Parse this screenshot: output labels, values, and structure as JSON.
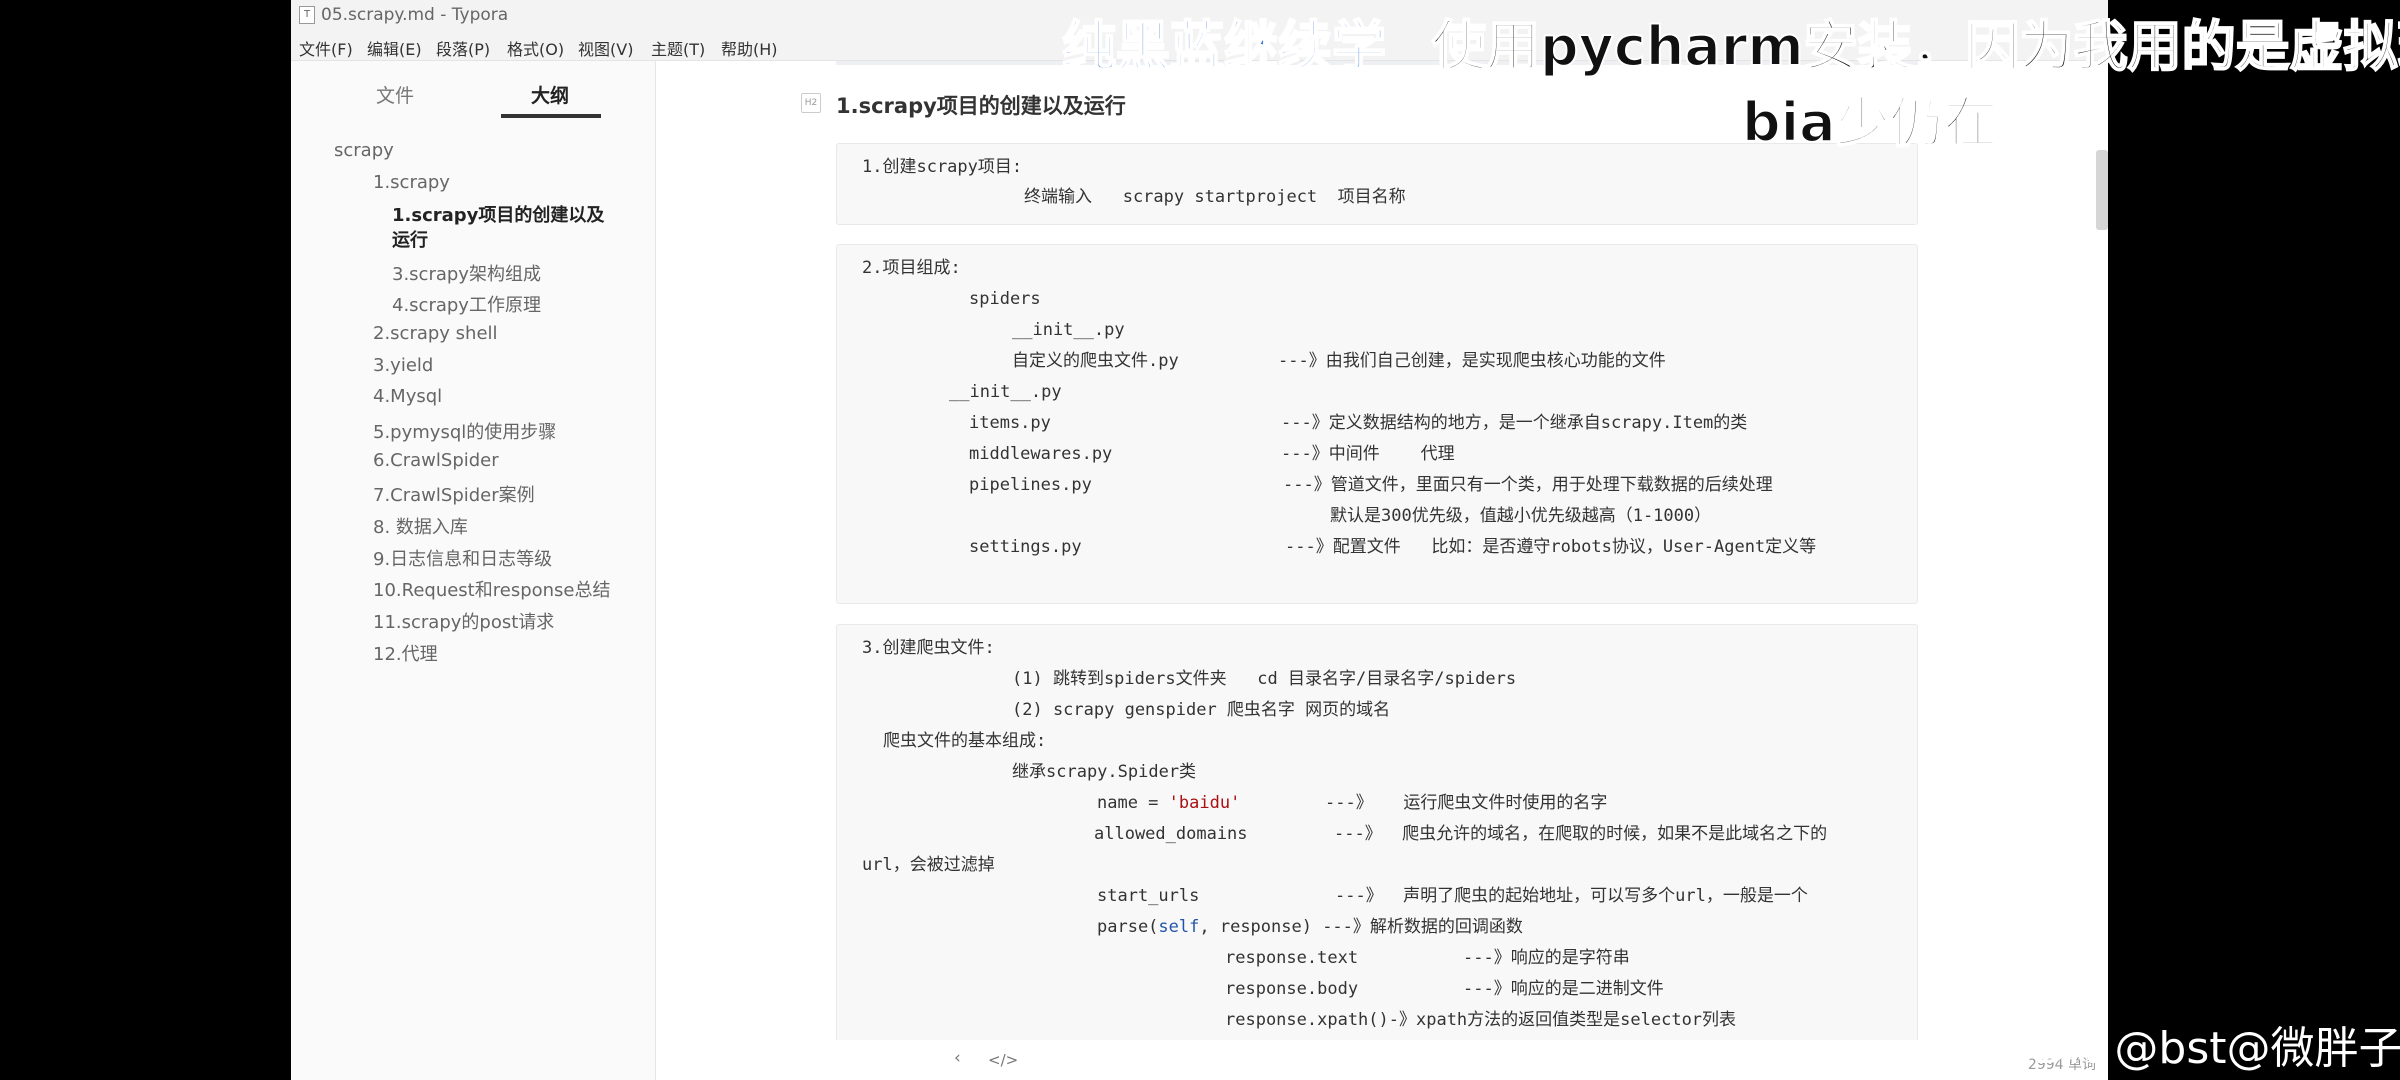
{
  "window": {
    "title": "05.scrapy.md - Typora"
  },
  "menu": [
    "文件(F)",
    "编辑(E)",
    "段落(P)",
    "格式(O)",
    "视图(V)",
    "主题(T)",
    "帮助(H)"
  ],
  "sidebar": {
    "tabs": [
      {
        "label": "文件"
      },
      {
        "label": "大纲"
      }
    ],
    "items": [
      {
        "label": "scrapy"
      },
      {
        "label": "1.scrapy"
      },
      {
        "label": "1.scrapy项目的创建以及运行"
      },
      {
        "label": "3.scrapy架构组成"
      },
      {
        "label": "4.scrapy工作原理"
      },
      {
        "label": "2.scrapy shell"
      },
      {
        "label": "3.yield"
      },
      {
        "label": "4.Mysql"
      },
      {
        "label": "5.pymysql的使用步骤"
      },
      {
        "label": "6.CrawlSpider"
      },
      {
        "label": "7.CrawlSpider案例"
      },
      {
        "label": "8. 数据入库"
      },
      {
        "label": "9.日志信息和日志等级"
      },
      {
        "label": "10.Request和response总结"
      },
      {
        "label": "11.scrapy的post请求"
      },
      {
        "label": "12.代理"
      }
    ]
  },
  "editor": {
    "heading": "1.scrapy项目的创建以及运行",
    "block1": {
      "line1": "1.创建scrapy项目:",
      "line2": "终端输入   scrapy startproject  项目名称"
    },
    "block2": {
      "title": "2.项目组成:",
      "spiders": "spiders",
      "init1": "__init__.py",
      "custom": "自定义的爬虫文件.py",
      "custom_desc": "---》由我们自己创建，是实现爬虫核心功能的文件",
      "init2": "__init__.py",
      "items": "items.py",
      "items_desc": "---》定义数据结构的地方，是一个继承自scrapy.Item的类",
      "middlewares": "middlewares.py",
      "middlewares_desc": "---》中间件    代理",
      "pipelines": "pipelines.py",
      "pipelines_desc": "---》管道文件，里面只有一个类，用于处理下载数据的后续处理",
      "pipelines_desc2": "默认是300优先级，值越小优先级越高（1-1000）",
      "settings": "settings.py",
      "settings_desc": "---》配置文件   比如：是否遵守robots协议，User-Agent定义等"
    },
    "block3": {
      "title": "3.创建爬虫文件:",
      "step1": "(1) 跳转到spiders文件夹   cd 目录名字/目录名字/spiders",
      "step2": "(2) scrapy genspider 爬虫名字 网页的域名",
      "basic": "爬虫文件的基本组成:",
      "inherit": "继承scrapy.Spider类",
      "name_code": "name = ",
      "name_val": "'baidu'",
      "name_desc": "---》   运行爬虫文件时使用的名字",
      "allowed": "allowed_domains",
      "allowed_desc": "---》  爬虫允许的域名，在爬取的时候，如果不是此域名之下的",
      "allowed_desc2": "url，会被过滤掉",
      "start": "start_urls",
      "start_desc": "---》  声明了爬虫的起始地址，可以写多个url，一般是一个",
      "parse_a": "parse(",
      "parse_self": "self",
      "parse_b": ", response) ---》解析数据的回调函数",
      "resp_text": "response.text",
      "resp_text_desc": "---》响应的是字符串",
      "resp_body": "response.body",
      "resp_body_desc": "---》响应的是二进制文件",
      "resp_xpath": "response.xpath()-》xpath方法的返回值类型是selector列表"
    }
  },
  "status": {
    "word_count": "2994 单词"
  },
  "overlay": {
    "part1": "纯黑蓝继续学",
    "part2": "使用pycharm安装，因为我用的是虚拟环",
    "part3": "bia少仍在"
  },
  "watermark": "CSDN @bst@微胖子"
}
